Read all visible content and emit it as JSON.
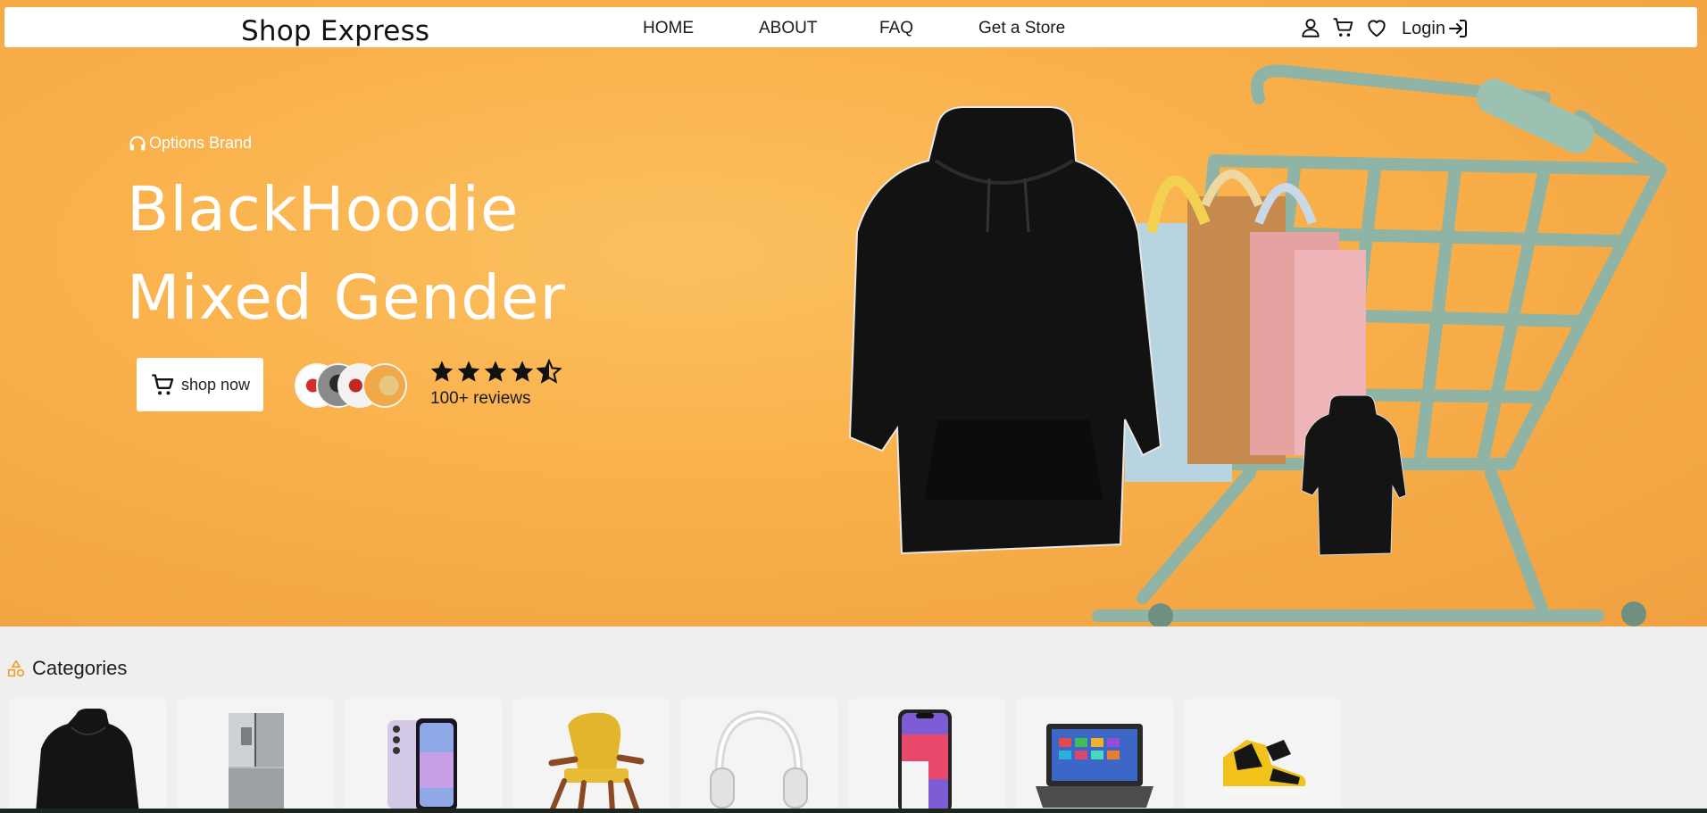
{
  "navbar": {
    "brand": "Shop Express",
    "links": [
      {
        "label": "HOME"
      },
      {
        "label": "ABOUT"
      },
      {
        "label": "FAQ"
      },
      {
        "label": "Get a Store"
      }
    ],
    "icons": [
      "user-icon",
      "cart-icon",
      "heart-icon"
    ],
    "login_label": "Login"
  },
  "hero": {
    "tagline": "Options Brand",
    "headline_line1": "BlackHoodie",
    "headline_line2": "Mixed Gender",
    "shop_button_label": "shop now",
    "rating": 4.5,
    "reviews_label": "100+ reviews"
  },
  "categories": {
    "title": "Categories",
    "items": [
      {
        "icon": "hoodie-icon"
      },
      {
        "icon": "refrigerator-icon"
      },
      {
        "icon": "phone-icon"
      },
      {
        "icon": "armchair-icon"
      },
      {
        "icon": "headphones-icon"
      },
      {
        "icon": "iphone-icon"
      },
      {
        "icon": "laptop-icon"
      },
      {
        "icon": "sneaker-icon"
      }
    ]
  },
  "colors": {
    "hero_bg": "#f9b04a",
    "nav_bg": "#ffffff",
    "accent": "#f0a030"
  }
}
